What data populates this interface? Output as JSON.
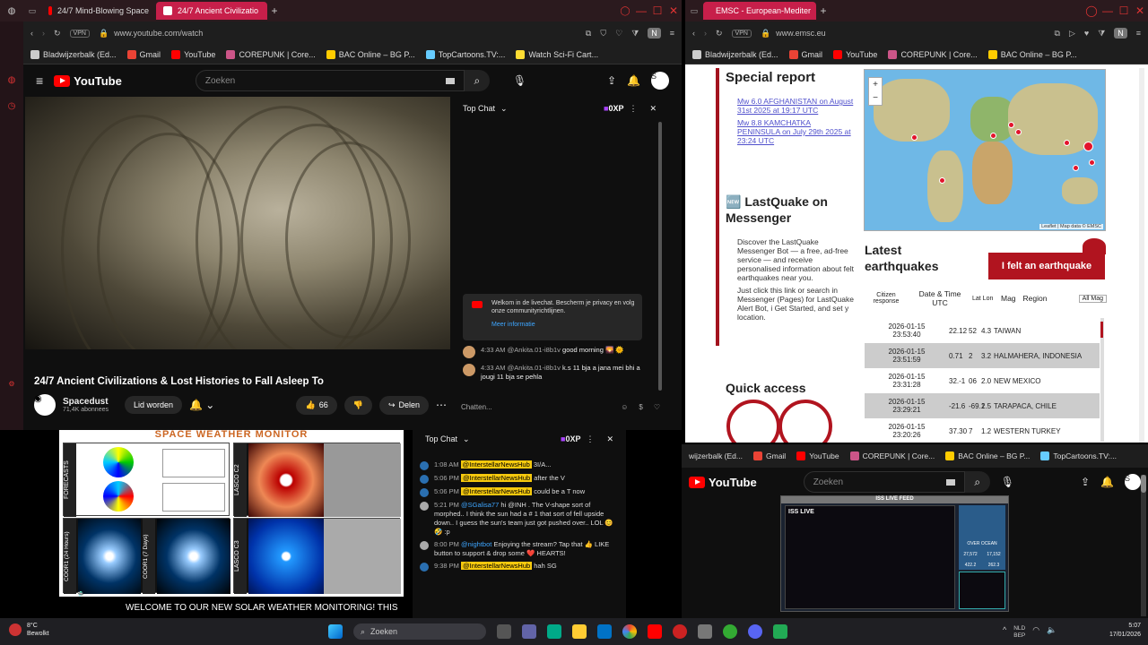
{
  "left_browser": {
    "tabs": [
      {
        "label": "24/7 Mind-Blowing Space"
      },
      {
        "label": "24/7 Ancient Civilizatio"
      }
    ],
    "url": "www.youtube.com/watch",
    "vpn": "VPN",
    "bookmarks": [
      "Bladwijzerbalk (Ed...",
      "Gmail",
      "YouTube",
      "COREPUNK | Core...",
      "BAC Online – BG P...",
      "TopCartoons.TV:...",
      "Watch Sci-Fi Cart..."
    ],
    "search_placeholder": "Zoeken",
    "avatar_letter": "S",
    "video_title": "24/7 Ancient Civilizations & Lost Histories to Fall Asleep To",
    "channel": "Spacedust",
    "subscribers": "71,4K abonnees",
    "join": "Lid worden",
    "likes": "66",
    "share": "Delen",
    "chat": {
      "header": "Top Chat",
      "points": "0XP",
      "welcome": "Welkom in de livechat. Bescherm je privacy en volg onze communityrichtlijnen.",
      "more_info": "Meer informatie",
      "messages": [
        {
          "time": "4:33 AM",
          "user": "@Ankita.01-i8b1v",
          "text": "good morning 🌄 🌞"
        },
        {
          "time": "4:33 AM",
          "user": "@Ankita.01-i8b1v",
          "text": "k.s 11 bja a jana mei bhi a jougi 11 bja se pehla"
        }
      ],
      "input_placeholder": "Chatten..."
    }
  },
  "right_browser": {
    "tab": "EMSC - European-Mediter",
    "url": "www.emsc.eu",
    "bookmarks": [
      "Bladwijzerbalk (Ed...",
      "Gmail",
      "YouTube",
      "COREPUNK | Core...",
      "BAC Online – BG P..."
    ],
    "special_report": "Special report",
    "reports": [
      "Mw 6.0 AFGHANISTAN on August 31st 2025 at 19:17 UTC",
      "Mw 8.8 KAMCHATKA PENINSULA on July 29th 2025 at 23:24 UTC"
    ],
    "lastquake_title": "🆕 LastQuake on Messenger",
    "lastquake_items": [
      "Discover the LastQuake Messenger Bot — a free, ad-free service — and receive personalised information about felt earthquakes near you.",
      "Just click this link or search in Messenger (Pages) for LastQuake Alert Bot, i Get Started, and set y location."
    ],
    "quick_access": "Quick access",
    "map_attribution": "Leaflet | Map data © EMSC",
    "latest": "Latest earthquakes",
    "felt_button": "I felt an earthquake",
    "table_headers": [
      "Citizen response",
      "Date & Time UTC",
      "Lat Lon",
      "Mag",
      "Region"
    ],
    "mag_filter": "All Mag",
    "rows": [
      {
        "date": "2026-01-15",
        "time": "23:53:40",
        "lat": "22.12",
        "lon": "52",
        "mag": "4.3",
        "region": "TAIWAN"
      },
      {
        "date": "2026-01-15",
        "time": "23:51:59",
        "lat": "0.71",
        "lon": "2",
        "mag": "3.2",
        "region": "HALMAHERA, INDONESIA"
      },
      {
        "date": "2026-01-15",
        "time": "23:31:28",
        "lat": "32.-1",
        "lon": "06",
        "mag": "2.0",
        "region": "NEW MEXICO"
      },
      {
        "date": "2026-01-15",
        "time": "23:29:21",
        "lat": "-21.6",
        "lon": "-69.1",
        "mag": "2.5",
        "region": "TARAPACA, CHILE"
      },
      {
        "date": "2026-01-15",
        "time": "23:20:26",
        "lat": "37.30",
        "lon": "7",
        "mag": "1.2",
        "region": "WESTERN TURKEY"
      }
    ]
  },
  "bottom_left": {
    "title": "SPACE WEATHER MONITOR",
    "panel_labels": [
      "FORECASTS",
      "LASCO C2",
      "COOR1 (24 Hours)",
      "COOR1 (7 Days)",
      "LASCO C3"
    ],
    "ticker": "WELCOME TO OUR NEW SOLAR WEATHER MONITORING!   THIS"
  },
  "bottom_chat": {
    "header": "Top Chat",
    "points": "0XP",
    "messages": [
      {
        "time": "1:08 AM",
        "user": "@InterstellarNewsHub",
        "text": "3I/A..."
      },
      {
        "time": "5:06 PM",
        "user": "@InterstellarNewsHub",
        "text": "after the V"
      },
      {
        "time": "5:06 PM",
        "user": "@InterstellarNewsHub",
        "text": "could be a T now"
      },
      {
        "time": "5:21 PM",
        "user": "@SGalisa77",
        "text": "hi @INH . The V-shape sort of morphed.. I think the sun had a # 1 that sort of fell upside down.. I guess the sun's team just got pushed over.. LOL 😊 🤣 :p"
      },
      {
        "time": "8:00 PM",
        "user": "@nightbot",
        "text": "Enjoying the stream? Tap that 👍 LIKE button to support & drop some ❤️ HEARTS!"
      },
      {
        "time": "9:38 PM",
        "user": "@InterstellarNewsHub",
        "text": "hah SG"
      }
    ]
  },
  "bottom_right": {
    "bookmarks": [
      "wijzerbalk (Ed...",
      "Gmail",
      "YouTube",
      "COREPUNK | Core...",
      "BAC Online – BG P...",
      "TopCartoons.TV:..."
    ],
    "search_placeholder": "Zoeken",
    "avatar_letter": "S",
    "iss_title": "ISS LIVE FEED",
    "iss_live": "ISS LIVE",
    "iss_overlay": "OVER OCEAN",
    "iss_nums": [
      "27,572",
      "17,152",
      "422.2",
      "262.3"
    ]
  },
  "taskbar": {
    "weather_temp": "8°C",
    "weather_desc": "Bewolkt",
    "search": "Zoeken",
    "lang1": "NLD",
    "lang2": "BEP",
    "time": "5:07",
    "date": "17/01/2026"
  }
}
